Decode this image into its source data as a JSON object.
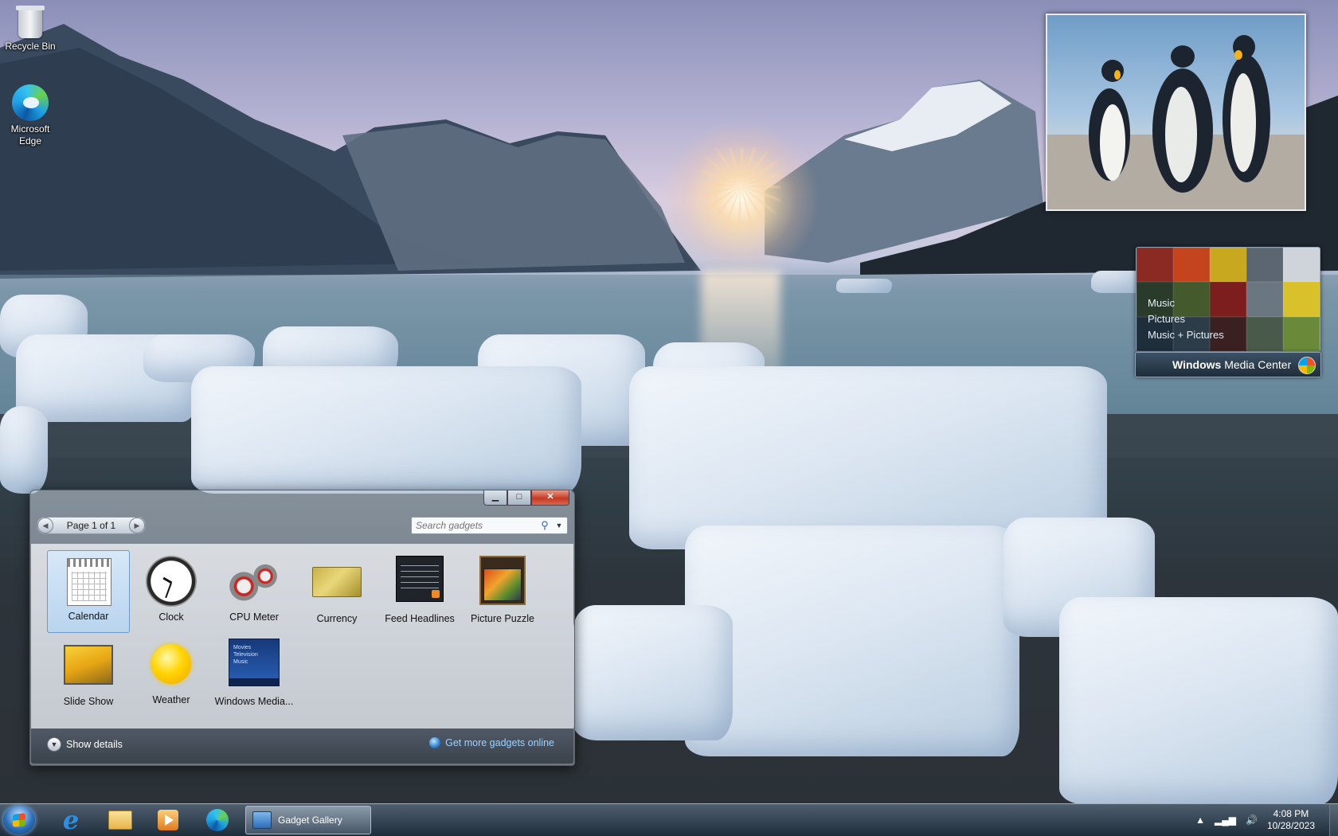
{
  "desktop": {
    "icons": [
      {
        "label": "Recycle Bin",
        "icon": "recycle-bin-icon"
      },
      {
        "label": "Microsoft Edge",
        "icon": "edge-icon"
      }
    ]
  },
  "media_center_gadget": {
    "menu": [
      "Music",
      "Pictures",
      "Music + Pictures"
    ],
    "brand_bold": "Windows",
    "brand_rest": " Media Center"
  },
  "gadget_gallery": {
    "pager_text": "Page 1 of 1",
    "search_placeholder": "Search gadgets",
    "gadgets": [
      {
        "label": "Calendar",
        "icon": "calendar-icon",
        "selected": true
      },
      {
        "label": "Clock",
        "icon": "clock-icon"
      },
      {
        "label": "CPU Meter",
        "icon": "cpu-meter-icon"
      },
      {
        "label": "Currency",
        "icon": "currency-icon"
      },
      {
        "label": "Feed Headlines",
        "icon": "feed-headlines-icon"
      },
      {
        "label": "Picture Puzzle",
        "icon": "picture-puzzle-icon"
      },
      {
        "label": "Slide Show",
        "icon": "slide-show-icon"
      },
      {
        "label": "Weather",
        "icon": "weather-icon"
      },
      {
        "label": "Windows Media...",
        "icon": "windows-media-center-icon"
      }
    ],
    "show_details": "Show details",
    "get_more": "Get more gadgets online"
  },
  "taskbar": {
    "task_label": "Gadget Gallery",
    "time": "4:08 PM",
    "date": "10/28/2023"
  }
}
